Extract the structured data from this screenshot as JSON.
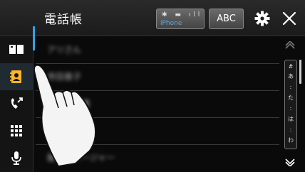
{
  "header": {
    "title": "電話帳",
    "device_name": "iPhone",
    "device_icons": "✱ ▬ ıll",
    "abc_label": "ABC"
  },
  "sidebar": {
    "items": [
      {
        "icon": "book-icon",
        "active": false
      },
      {
        "icon": "contacts-icon",
        "active": true
      },
      {
        "icon": "call-history-icon",
        "active": false
      },
      {
        "icon": "keypad-icon",
        "active": false
      },
      {
        "icon": "microphone-icon",
        "active": false
      }
    ]
  },
  "contacts": [
    {
      "name": "アリさん"
    },
    {
      "name": "寺田善子"
    },
    {
      "name": "高橋"
    },
    {
      "name": ""
    },
    {
      "name": "藤森マネージャー"
    }
  ],
  "index": [
    "#",
    "あ",
    ":",
    "た",
    ":",
    "は",
    ":",
    "わ"
  ],
  "colors": {
    "accent": "#34a1e8",
    "device_text": "#5aa6e6"
  }
}
